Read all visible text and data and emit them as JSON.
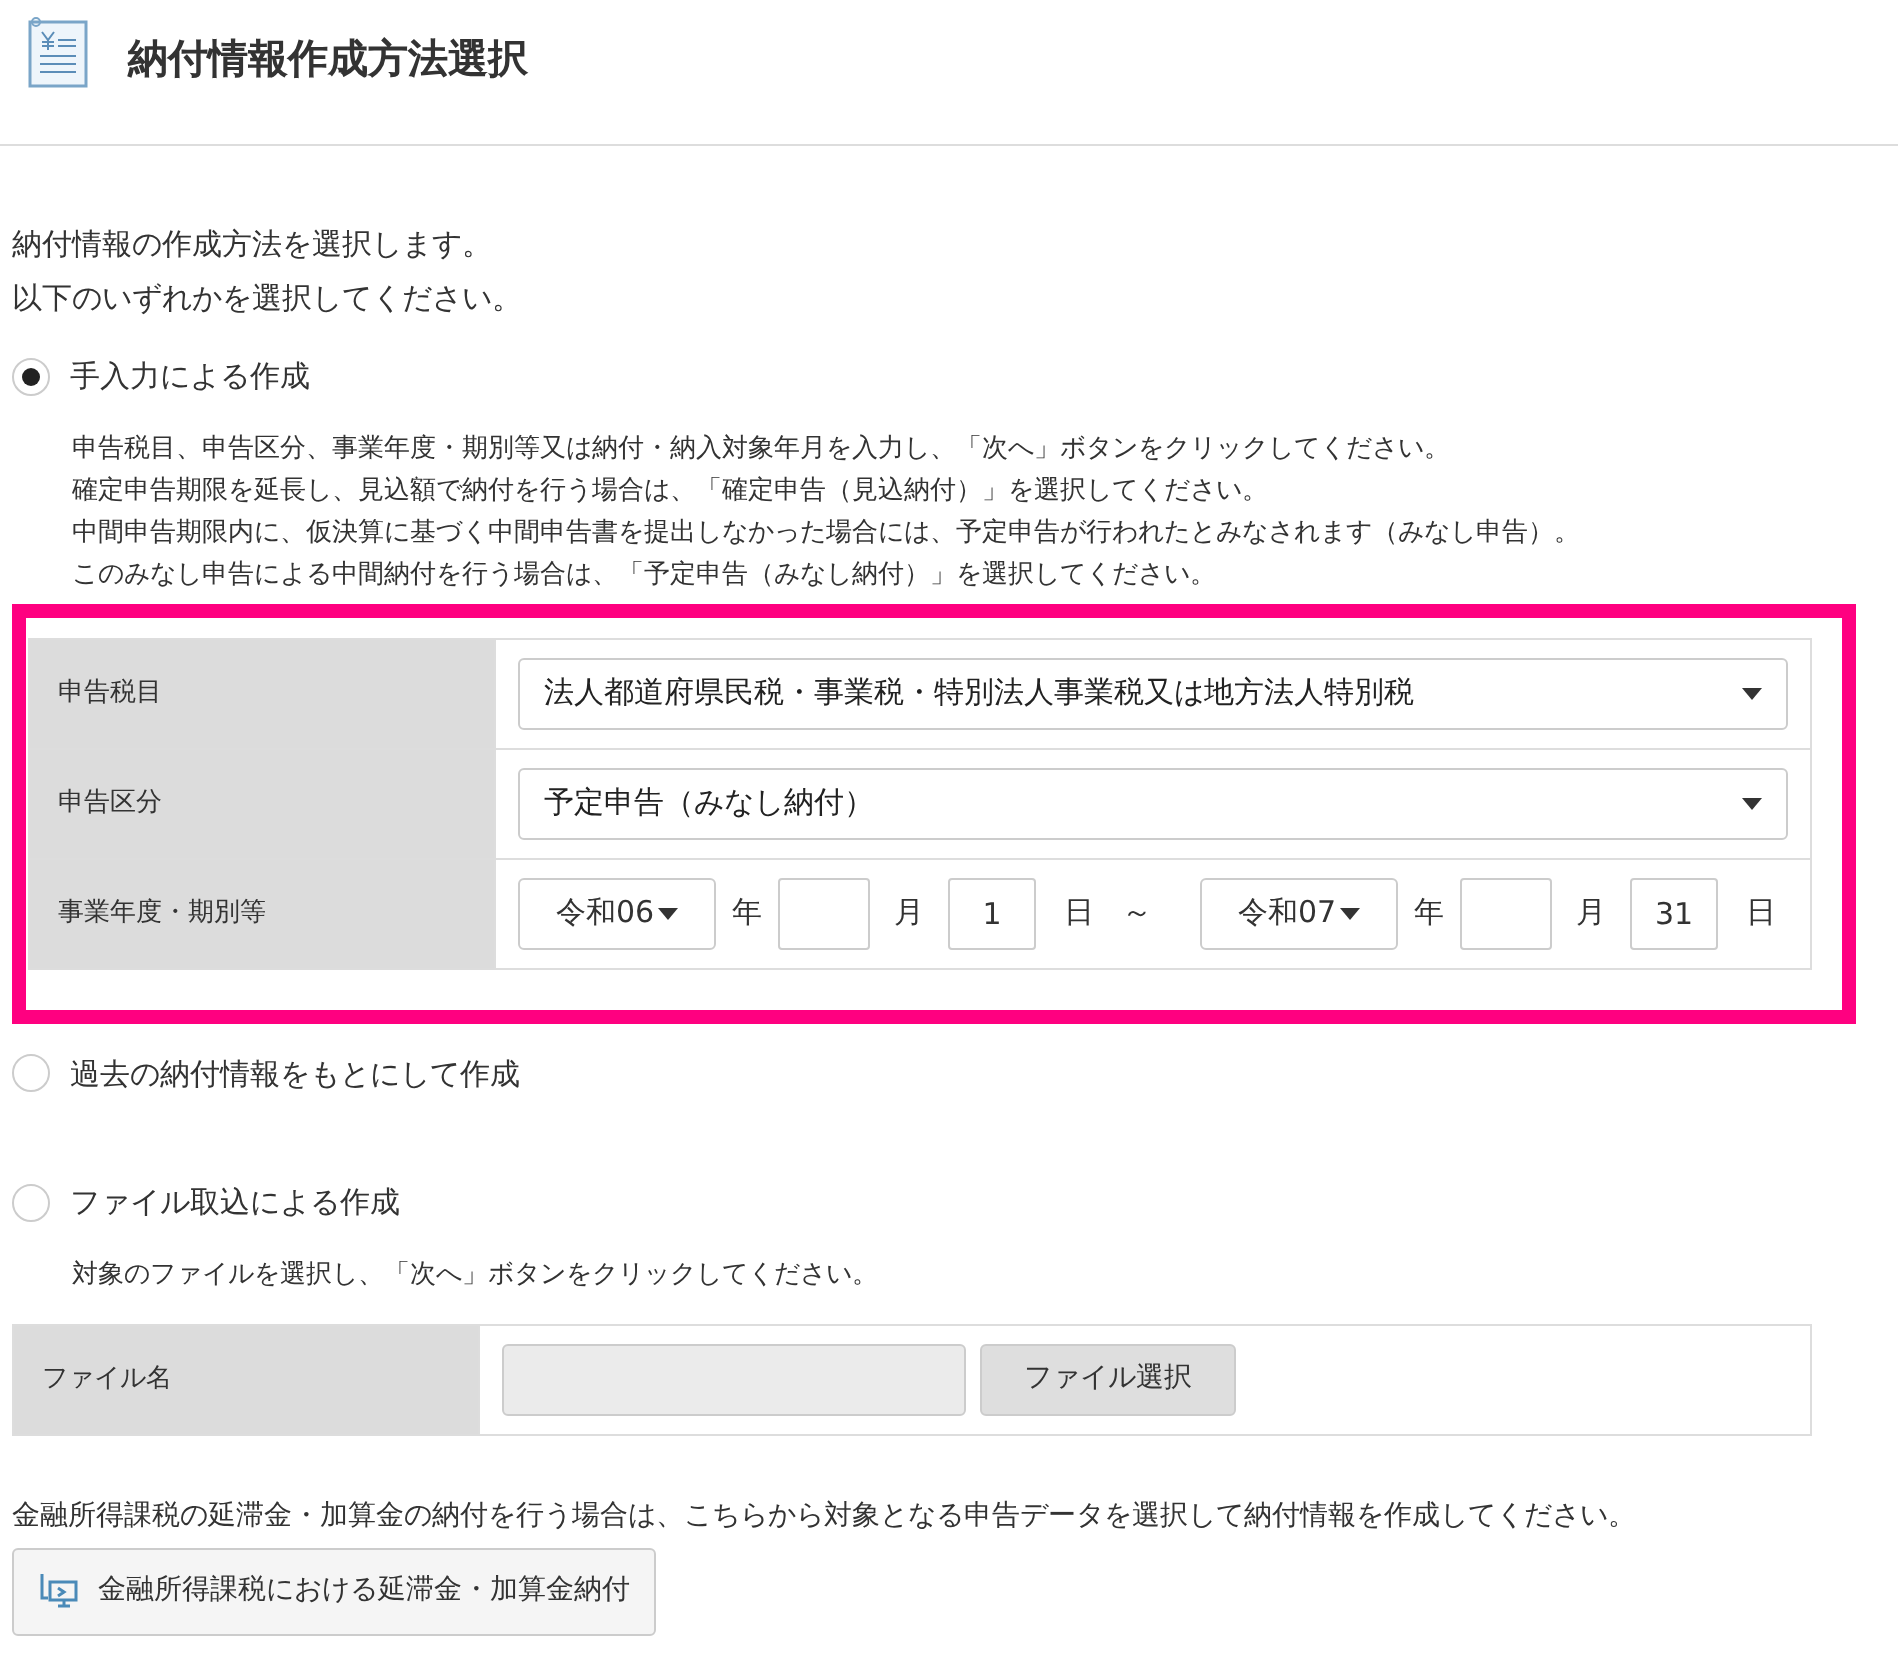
{
  "header": {
    "title": "納付情報作成方法選択"
  },
  "intro": [
    "納付情報の作成方法を選択します。",
    "以下のいずれかを選択してください。"
  ],
  "methods": [
    {
      "label": "手入力による作成",
      "selected": true,
      "highlighted": true,
      "description": [
        "申告税目、申告区分、事業年度・期別等又は納付・納入対象年月を入力し、「次へ」ボタンをクリックしてください。",
        "確定申告期限を延長し、見込額で納付を行う場合は、「確定申告（見込納付）」を選択してください。",
        "中間申告期限内に、仮決算に基づく中間申告書を提出しなかった場合には、予定申告が行われたとみなされます（みなし申告）。",
        "このみなし申告による中間納付を行う場合は、「予定申告（みなし納付）」を選択してください。"
      ],
      "rows": [
        {
          "kind": "select",
          "label": "申告税目",
          "value": "法人都道府県民税・事業税・特別法人事業税又は地方法人特別税"
        },
        {
          "kind": "select",
          "label": "申告区分",
          "value": "予定申告（みなし納付）"
        },
        {
          "kind": "period",
          "label": "事業年度・期別等",
          "separator": "～",
          "from": {
            "era": "令和06",
            "year_unit": "年",
            "month_unit": "月",
            "day": "1",
            "day_unit": "日"
          },
          "to": {
            "era": "令和07",
            "year_unit": "年",
            "month_unit": "月",
            "day": "31",
            "day_unit": "日"
          }
        }
      ]
    },
    {
      "label": "過去の納付情報をもとにして作成",
      "selected": false,
      "highlighted": false
    },
    {
      "label": "ファイル取込による作成",
      "selected": false,
      "highlighted": false,
      "description": [
        "対象のファイルを選択し、「次へ」ボタンをクリックしてください。"
      ],
      "rows": [
        {
          "kind": "file",
          "label": "ファイル名",
          "button": "ファイル選択",
          "disabled": true
        }
      ]
    }
  ],
  "footer": {
    "note": "金融所得課税の延滞金・加算金の納付を行う場合は、こちらから対象となる申告データを選択して納付情報を作成してください。",
    "button": "金融所得課税における延滞金・加算金納付"
  }
}
